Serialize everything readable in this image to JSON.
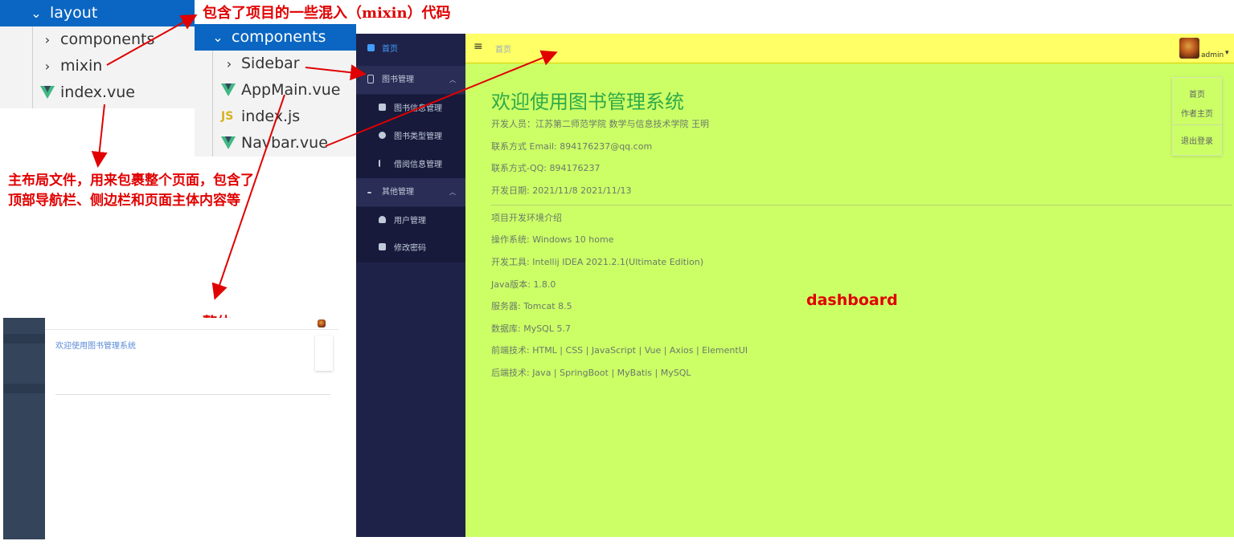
{
  "file_tree_layout": {
    "folder": "layout",
    "items": [
      "components",
      "mixin",
      "index.vue"
    ]
  },
  "file_tree_components": {
    "folder": "components",
    "items": [
      "Sidebar",
      "AppMain.vue",
      "index.js",
      "Navbar.vue"
    ]
  },
  "annotations": {
    "mixin_note": "包含了项目的一些混入（mixin）代码",
    "layout_note_line1": "主布局文件，用来包裹整个页面，包含了",
    "layout_note_line2": "顶部导航栏、侧边栏和页面主体内容等",
    "whole_label": "整体",
    "dashboard_label": "dashboard"
  },
  "colors": {
    "annotation": "#e00000",
    "sidebar_bg": "#1f2248",
    "navbar_bg": "#ffff66",
    "content_bg": "#ccff66",
    "title": "#2eaa4a"
  },
  "sidebar": {
    "items": [
      {
        "label": "首页",
        "icon": "dashboard-icon"
      },
      {
        "label": "图书管理",
        "icon": "book-icon"
      },
      {
        "label": "图书信息管理",
        "icon": "document-icon"
      },
      {
        "label": "图书类型管理",
        "icon": "category-icon"
      },
      {
        "label": "借阅信息管理",
        "icon": "borrow-icon"
      },
      {
        "label": "其他管理",
        "icon": "gear-icon"
      },
      {
        "label": "用户管理",
        "icon": "user-icon"
      },
      {
        "label": "修改密码",
        "icon": "lock-icon"
      }
    ]
  },
  "navbar": {
    "hamburger": "≡",
    "breadcrumb": "首页",
    "user": "admin",
    "caret": "▾"
  },
  "dropdown": {
    "items": [
      "首页",
      "作者主页",
      "退出登录"
    ]
  },
  "dashboard": {
    "title": "欢迎使用图书管理系统",
    "developer": "开发人员：江苏第二师范学院 数学与信息技术学院 王明",
    "email": "联系方式 Email: 894176237@qq.com",
    "qq": "联系方式-QQ: 894176237",
    "dates": "开发日期: 2021/11/8      2021/11/13",
    "env_heading": "项目开发环境介绍",
    "os": "操作系统: Windows 10 home",
    "ide": "开发工具: Intellij IDEA 2021.2.1(Ultimate Edition)",
    "java": "Java版本: 1.8.0",
    "server": "服务器: Tomcat 8.5",
    "db": "数据库: MySQL 5.7",
    "frontend": "前端技术: HTML | CSS | JavaScript | Vue | Axios | ElementUI",
    "backend": "后端技术: Java | SpringBoot | MyBatis | MySQL"
  },
  "thumbnail": {
    "title": "欢迎使用图书管理系统"
  }
}
